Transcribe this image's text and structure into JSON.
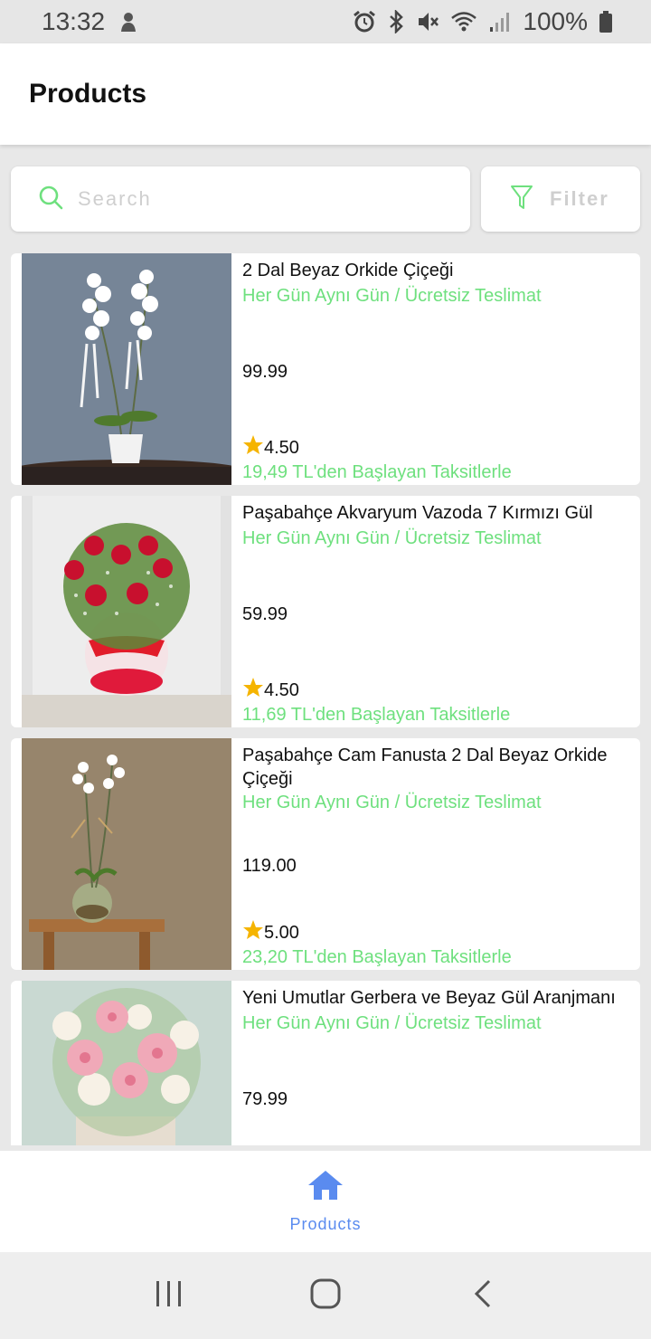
{
  "status_bar": {
    "time": "13:32",
    "battery": "100%"
  },
  "app_bar": {
    "title": "Products"
  },
  "search": {
    "placeholder": "Search",
    "filter_label": "Filter"
  },
  "products": [
    {
      "name": "2 Dal Beyaz Orkide Çiçeği",
      "delivery": "Her Gün Aynı Gün / Ücretsiz Teslimat",
      "price": "99.99",
      "rating": "4.50",
      "installment": "19,49 TL'den Başlayan Taksitlerle"
    },
    {
      "name": "Paşabahçe Akvaryum Vazoda 7 Kırmızı Gül",
      "delivery": "Her Gün Aynı Gün / Ücretsiz Teslimat",
      "price": "59.99",
      "rating": "4.50",
      "installment": "11,69 TL'den Başlayan Taksitlerle"
    },
    {
      "name": "Paşabahçe Cam Fanusta 2 Dal Beyaz Orkide Çiçeği",
      "delivery": "Her Gün Aynı Gün / Ücretsiz Teslimat",
      "price": "119.00",
      "rating": "5.00",
      "installment": "23,20 TL'den Başlayan Taksitlerle"
    },
    {
      "name": "Yeni Umutlar Gerbera ve Beyaz Gül Aranjmanı",
      "delivery": "Her Gün Aynı Gün / Ücretsiz Teslimat",
      "price": "79.99"
    }
  ],
  "bottom_nav": {
    "items": [
      {
        "label": "Products",
        "icon": "home-icon",
        "active": true
      }
    ]
  },
  "colors": {
    "accent_green": "#6ee07e",
    "nav_blue": "#5a8bef",
    "star": "#f5b400"
  }
}
